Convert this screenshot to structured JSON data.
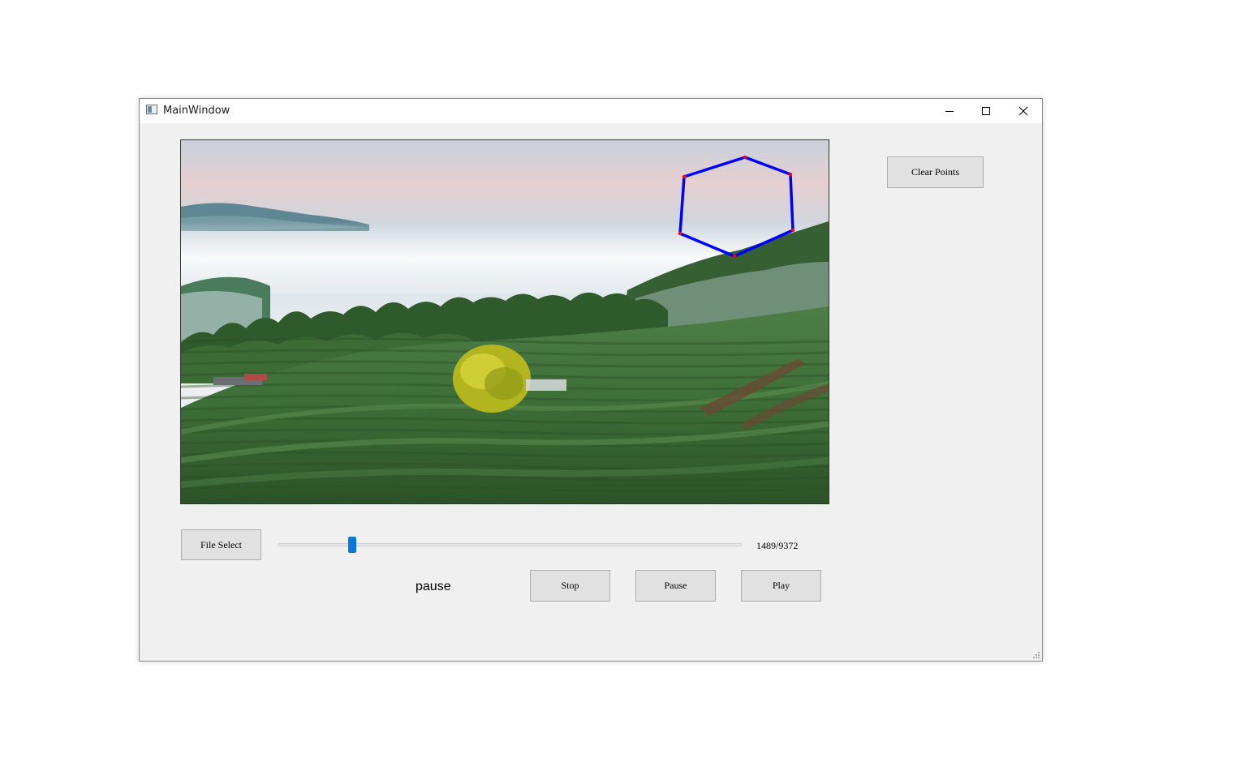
{
  "window": {
    "title": "MainWindow",
    "controls": {
      "minimize": "minimize-icon",
      "maximize": "maximize-icon",
      "close": "close-icon"
    }
  },
  "video": {
    "scene": "landscape-frame",
    "overlay_polygon_color": "#0000ff",
    "overlay_vertex_color": "#ff0000"
  },
  "buttons": {
    "clear_points": "Clear Points",
    "file_select": "File Select",
    "stop": "Stop",
    "pause": "Pause",
    "play": "Play"
  },
  "playback": {
    "current_frame": 1489,
    "total_frames": 9372,
    "frame_label": "1489/9372",
    "status": "pause"
  },
  "colors": {
    "accent": "#0a78d7",
    "button_bg": "#e1e1e1",
    "window_bg": "#f0f0f0"
  }
}
